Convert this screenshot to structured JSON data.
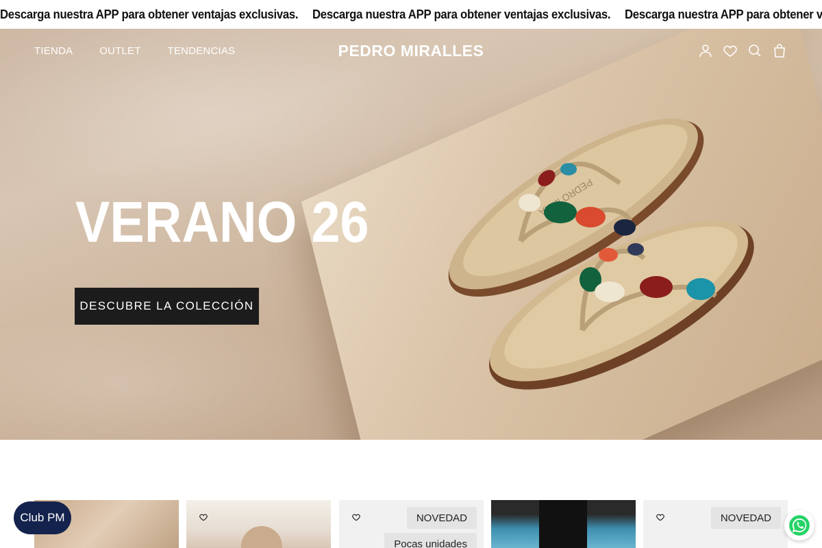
{
  "announcement": {
    "items": [
      "Descarga nuestra APP para obtener ventajas exclusivas.",
      "Descarga nuestra APP para obtener ventajas exclusivas.",
      "Descarga nuestra APP para obtener ventajas exclusivas."
    ]
  },
  "header": {
    "nav": [
      "TIENDA",
      "OUTLET",
      "TENDENCIAS"
    ],
    "logo": "PEDRO MIRALLES",
    "icons": [
      "user-icon",
      "heart-icon",
      "search-icon",
      "bag-icon"
    ]
  },
  "hero": {
    "title": "VERANO 26",
    "cta": "DESCUBRE LA COLECCIÓN"
  },
  "products": {
    "badges": {
      "novedad": "NOVEDAD",
      "pocas": "Pocas unidades"
    }
  },
  "floating": {
    "club": "Club PM",
    "whatsapp_icon": "whatsapp-icon"
  },
  "colors": {
    "cta_bg": "#1c1c1c",
    "club_bg": "#14234d",
    "whatsapp": "#25d366"
  }
}
